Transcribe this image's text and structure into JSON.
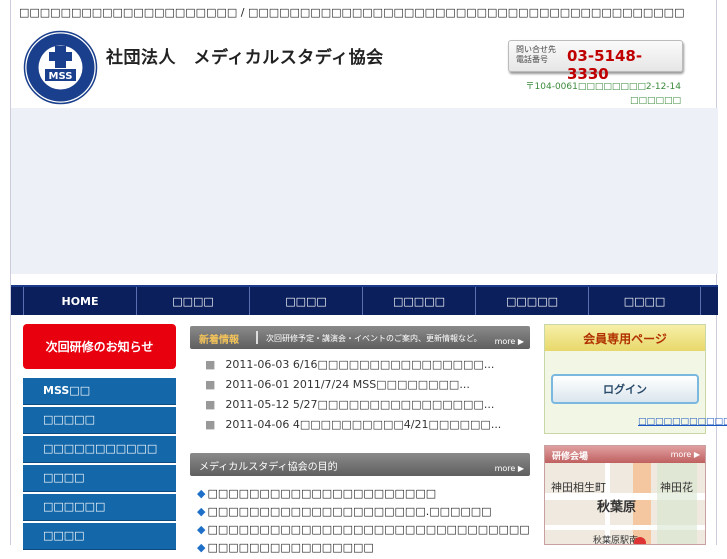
{
  "header": {
    "top_text": "□□□□□□□□□□□□□□□□□□□□□ / □□□□□□□□□□□□□□□□□□□□□□□□□□□□□□□□□□□□□□□□□□",
    "org_name": "社団法人　メディカルスタディ協会",
    "logo_text": "MSS",
    "contact_label": "問い合せ先 電話番号",
    "phone": "03-5148-3330",
    "address_line1": "〒104-0061□□□□□□□□2-12-14",
    "address_line2": "□□□□□□"
  },
  "nav": {
    "items": [
      {
        "label": "HOME"
      },
      {
        "label": "□□□□"
      },
      {
        "label": "□□□□"
      },
      {
        "label": "□□□□□"
      },
      {
        "label": "□□□□□"
      },
      {
        "label": "□□□□"
      }
    ]
  },
  "sidebar": {
    "notice_label": "次回研修のお知らせ",
    "menu": [
      {
        "label": "MSS□□"
      },
      {
        "label": "□□□□□"
      },
      {
        "label": "□□□□□□□□□□□"
      },
      {
        "label": "□□□□"
      },
      {
        "label": "□□□□□□"
      },
      {
        "label": "□□□□"
      }
    ]
  },
  "news": {
    "tag": "新着情報",
    "subtitle": "次回研修予定・講演会・イベントのご案内、更新情報など。",
    "more": "more",
    "items": [
      {
        "text": "2011-06-03 6/16□□□□□□□□□□□□□□□□..."
      },
      {
        "text": "2011-06-01 2011/7/24 MSS□□□□□□□□..."
      },
      {
        "text": "2011-05-12 5/27□□□□□□□□□□□□□□□□..."
      },
      {
        "text": "2011-04-06 4□□□□□□□□□□4/21□□□□□□..."
      }
    ]
  },
  "purpose": {
    "title": "メディカルスタディ協会の目的",
    "more": "more",
    "items": [
      {
        "text": "□□□□□□□□□□□□□□□□□□□□□□"
      },
      {
        "text": "□□□□□□□□□□□□□□□□□□□□□.□□□□□□"
      },
      {
        "text": "□□□□□□□□□□□□□□□□□□□□□□□□□□□□□□□□"
      },
      {
        "text": "□□□□□□□□□□□□□□□□"
      }
    ]
  },
  "members": {
    "title": "会員専用ページ",
    "login_label": "ログイン",
    "link_text": "□□□□□□□□□□□"
  },
  "venue": {
    "title": "研修会場",
    "more": "more",
    "map_labels": [
      "神田相生町",
      "神田花",
      "秋葉原",
      "秋葉原駅南"
    ]
  }
}
